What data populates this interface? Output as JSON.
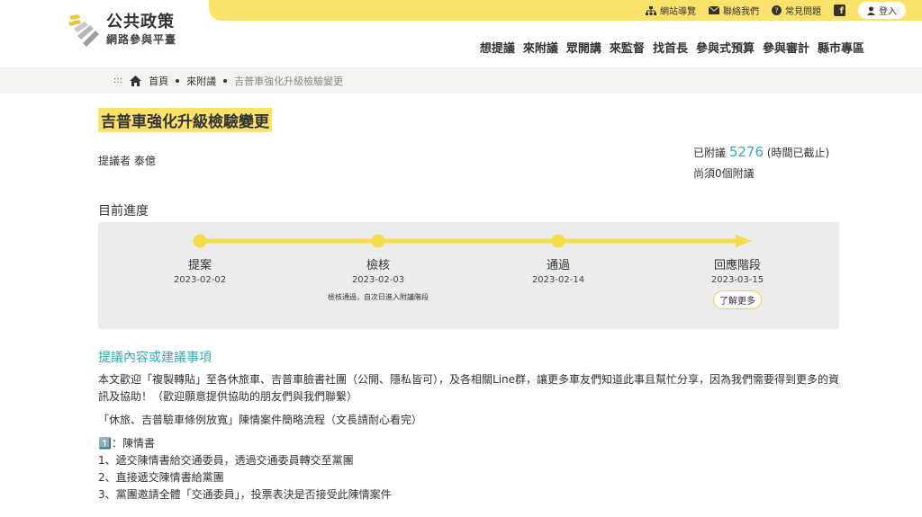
{
  "topbar": {
    "sitemap": "網站導覽",
    "contact": "聯絡我們",
    "faq": "常見問題",
    "login": "登入"
  },
  "logo": {
    "title": "公共政策",
    "subtitle": "網路參與平臺"
  },
  "nav": [
    "想提議",
    "來附議",
    "眾開講",
    "來監督",
    "找首長",
    "參與式預算",
    "參與審計",
    "縣市專區"
  ],
  "breadcrumb": {
    "home": "首頁",
    "level1": "來附議",
    "current": "吉普車強化升級檢驗變更"
  },
  "proposal": {
    "title": "吉普車強化升級檢驗變更",
    "proposer_label": "提議者",
    "proposer": "泰億",
    "signed_label": "已附議",
    "signed_count": "5276",
    "signed_status": "(時間已截止)",
    "remaining": "尚須0個附議"
  },
  "progress": {
    "label": "目前進度",
    "stages": [
      {
        "name": "提案",
        "date": "2023-02-02",
        "note": ""
      },
      {
        "name": "檢核",
        "date": "2023-02-03",
        "note": "檢核通過，自次日進入附議階段"
      },
      {
        "name": "通過",
        "date": "2023-02-14",
        "note": ""
      },
      {
        "name": "回應階段",
        "date": "2023-03-15",
        "note": ""
      }
    ],
    "more_button": "了解更多",
    "track_color": "#f5dc4a"
  },
  "content": {
    "section_title": "提議內容或建議事項",
    "para1": "本文歡迎「複製轉貼」至各休旅車、吉普車臉書社團（公開、隱私皆可），及各相關Line群，讓更多車友們知道此事且幫忙分享，因為我們需要得到更多的資訊及協助！（歡迎願意提供協助的朋友們與我們聯繫）",
    "para2": "「休旅、吉普驗車條例放寬」陳情案件簡略流程（文長請耐心看完）",
    "list_title": "1️⃣：陳情書",
    "list": [
      "1、遞交陳情書給交通委員，透過交通委員轉交至黨團",
      "2、直接遞交陳情書給黨團",
      "3、黨團邀請全體「交通委員」，投票表決是否接受此陳情案件"
    ]
  },
  "colors": {
    "accent": "#fbe36b",
    "link": "#3aa7b8"
  }
}
